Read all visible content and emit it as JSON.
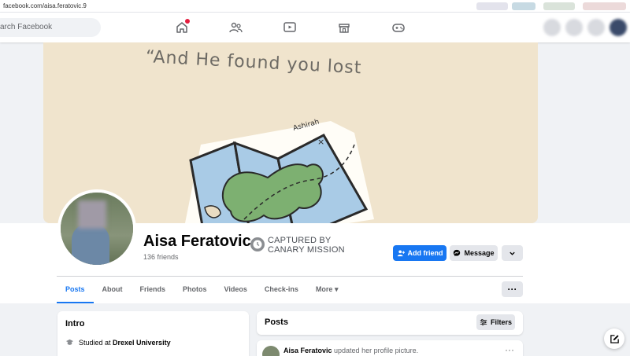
{
  "browser": {
    "url": "facebook.com/aisa.feratovic.9"
  },
  "topnav": {
    "search_placeholder": "Search Facebook",
    "search_visible": "arch Facebook"
  },
  "cover": {
    "quote_text": "“And He found you lost",
    "map_label": "Ashirah"
  },
  "profile": {
    "name": "Aisa Feratovic",
    "friends": "136 friends",
    "captured_line1": "CAPTURED BY",
    "captured_line2": "CANARY MISSION"
  },
  "actions": {
    "add_friend": "Add friend",
    "message": "Message"
  },
  "tabs": [
    "Posts",
    "About",
    "Friends",
    "Photos",
    "Videos",
    "Check-ins",
    "More"
  ],
  "intro": {
    "title": "Intro",
    "studied_prefix": "Studied at ",
    "school": "Drexel University"
  },
  "posts": {
    "title": "Posts",
    "filters": "Filters",
    "author": "Aisa Feratovic",
    "action": " updated her profile picture."
  },
  "colors": {
    "accent": "#1877f2",
    "bg": "#f0f2f5"
  }
}
